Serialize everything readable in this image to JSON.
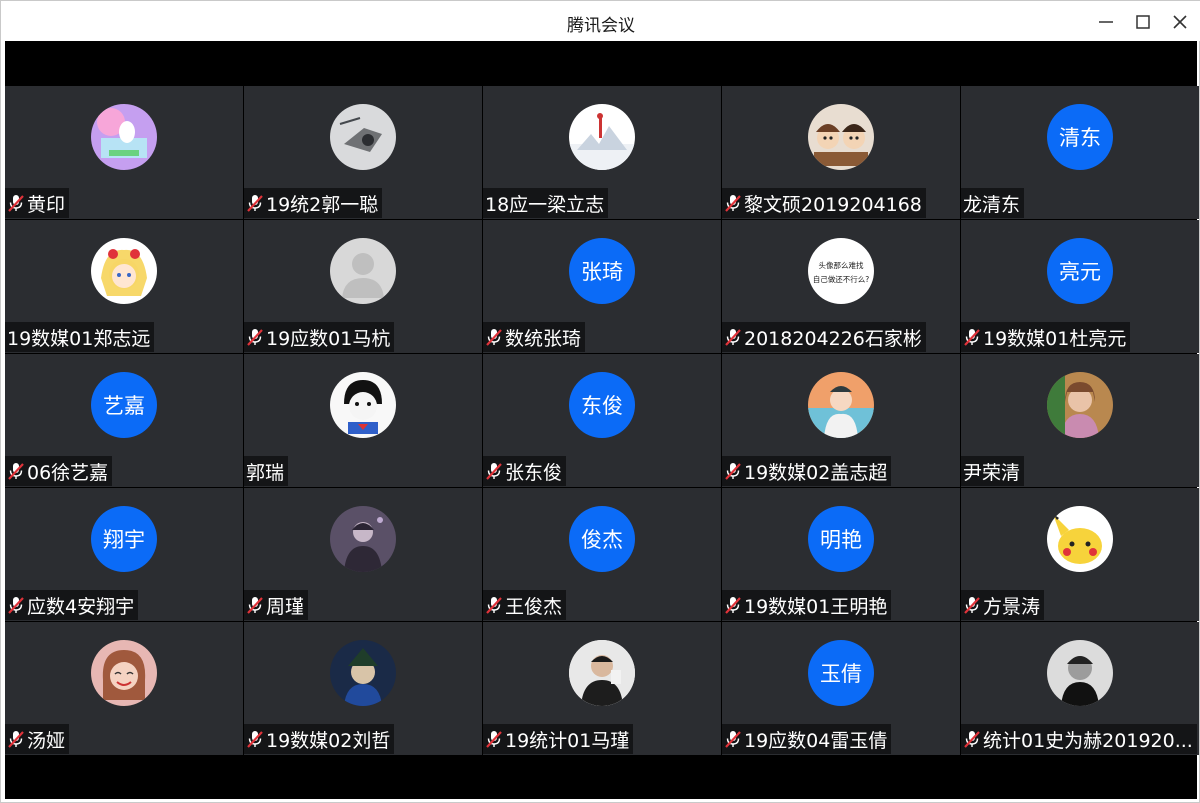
{
  "window": {
    "title": "腾讯会议"
  },
  "colors": {
    "tile_bg": "#2b2d31",
    "avatar_blue": "#0b6bf7",
    "label_bg": "#141517",
    "mute_red": "#e0333a"
  },
  "participants": [
    {
      "name": "黄印",
      "muted": true,
      "avatar_type": "image",
      "avatar_icon": "pastel-anime-avatar"
    },
    {
      "name": "19统2郭一聪",
      "muted": true,
      "avatar_type": "image",
      "avatar_icon": "sketch-avatar"
    },
    {
      "name": "18应一梁立志",
      "muted": false,
      "avatar_type": "image",
      "avatar_icon": "snow-scene-avatar"
    },
    {
      "name": "黎文硕2019204168",
      "muted": true,
      "avatar_type": "image",
      "avatar_icon": "cartoon-group-avatar"
    },
    {
      "name": "龙清东",
      "muted": false,
      "avatar_type": "text",
      "avatar_text": "清东"
    },
    {
      "name": "19数媒01郑志远",
      "muted": false,
      "avatar_type": "image",
      "avatar_icon": "anime-girl-avatar"
    },
    {
      "name": "19应数01马杭",
      "muted": true,
      "avatar_type": "image",
      "avatar_icon": "default-person-avatar"
    },
    {
      "name": "数统张琦",
      "muted": true,
      "avatar_type": "text",
      "avatar_text": "张琦"
    },
    {
      "name": "2018204226石家彬",
      "muted": true,
      "avatar_type": "image",
      "avatar_icon": "text-meme-avatar",
      "avatar_lines": [
        "头像那么难找",
        "自己做还不行么?"
      ]
    },
    {
      "name": "19数媒01杜亮元",
      "muted": true,
      "avatar_type": "text",
      "avatar_text": "亮元"
    },
    {
      "name": "06徐艺嘉",
      "muted": true,
      "avatar_type": "text",
      "avatar_text": "艺嘉"
    },
    {
      "name": "郭瑞",
      "muted": false,
      "avatar_type": "image",
      "avatar_icon": "meme-face-avatar"
    },
    {
      "name": "张东俊",
      "muted": true,
      "avatar_type": "text",
      "avatar_text": "东俊"
    },
    {
      "name": "19数媒02盖志超",
      "muted": true,
      "avatar_type": "image",
      "avatar_icon": "illustrated-boy-avatar"
    },
    {
      "name": "尹荣清",
      "muted": false,
      "avatar_type": "image",
      "avatar_icon": "girl-illustration-avatar"
    },
    {
      "name": "应数4安翔宇",
      "muted": true,
      "avatar_type": "text",
      "avatar_text": "翔宇"
    },
    {
      "name": "周瑾",
      "muted": true,
      "avatar_type": "image",
      "avatar_icon": "dark-portrait-avatar"
    },
    {
      "name": "王俊杰",
      "muted": true,
      "avatar_type": "text",
      "avatar_text": "俊杰"
    },
    {
      "name": "19数媒01王明艳",
      "muted": true,
      "avatar_type": "text",
      "avatar_text": "明艳"
    },
    {
      "name": "方景涛",
      "muted": true,
      "avatar_type": "image",
      "avatar_icon": "pikachu-avatar"
    },
    {
      "name": "汤娅",
      "muted": true,
      "avatar_type": "image",
      "avatar_icon": "smiling-girl-avatar"
    },
    {
      "name": "19数媒02刘哲",
      "muted": true,
      "avatar_type": "image",
      "avatar_icon": "anime-character-avatar"
    },
    {
      "name": "19统计01马瑾",
      "muted": true,
      "avatar_type": "image",
      "avatar_icon": "photo-person-avatar"
    },
    {
      "name": "19应数04雷玉倩",
      "muted": true,
      "avatar_type": "text",
      "avatar_text": "玉倩"
    },
    {
      "name": "统计01史为赫201920...",
      "muted": true,
      "avatar_type": "image",
      "avatar_icon": "bw-portrait-avatar"
    }
  ]
}
